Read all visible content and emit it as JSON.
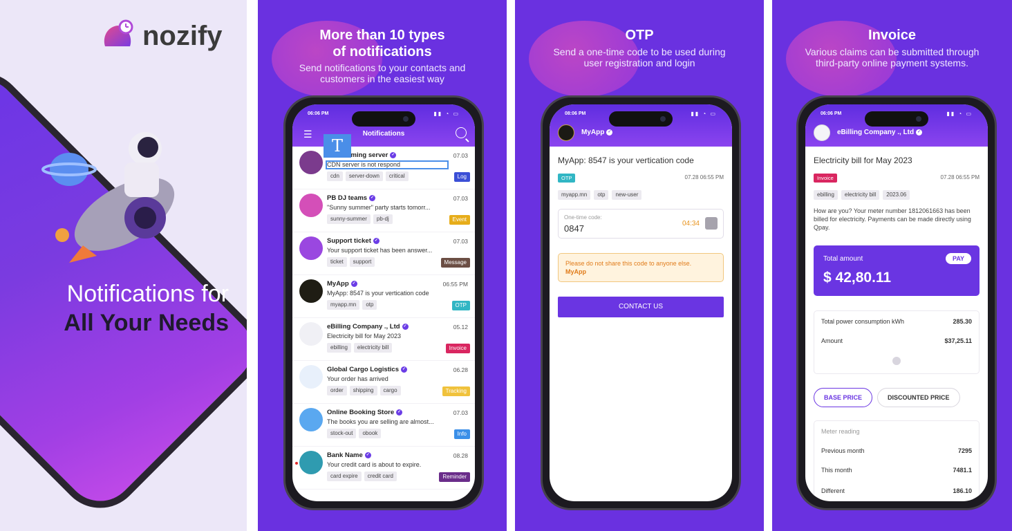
{
  "brand": {
    "name": "nozify"
  },
  "hero": {
    "line1": "Notifications for",
    "line2": "All Your Needs"
  },
  "panel2": {
    "title1": "More than 10 types",
    "title2": "of notifications",
    "subtitle1": "Send notifications to your contacts and",
    "subtitle2": "customers in the easiest way",
    "screen": {
      "time": "06:06 PM",
      "title": "Notifications",
      "items": [
        {
          "name": "ESA Gaming server",
          "date": "07.03",
          "body": "CDN server is not respond",
          "tags": [
            "cdn",
            "server-down",
            "critical"
          ],
          "badge": "Log",
          "badge_color": "#3b4fd6",
          "avatar_color": "#7b3b8d"
        },
        {
          "name": "PB DJ teams",
          "date": "07.03",
          "body": "\"Sunny summer\" party starts tomorr...",
          "tags": [
            "sunny-summer",
            "pb-dj"
          ],
          "badge": "Event",
          "badge_color": "#e7ad1a",
          "avatar_color": "#d44fb8"
        },
        {
          "name": "Support ticket",
          "date": "07.03",
          "body": "Your support ticket has been answer...",
          "tags": [
            "ticket",
            "support"
          ],
          "badge": "Message",
          "badge_color": "#6b4e44",
          "avatar_color": "#9a47e0"
        },
        {
          "name": "MyApp",
          "date": "06:55 PM",
          "body": "MyApp: 8547 is your vertication code",
          "tags": [
            "myapp.mn",
            "otp"
          ],
          "badge": "OTP",
          "badge_color": "#31b6c4",
          "avatar_color": "#1f1d14"
        },
        {
          "name": "eBilling Company ., Ltd",
          "date": "05.12",
          "body": "Electricity bill for May 2023",
          "tags": [
            "ebilling",
            "electricity bill"
          ],
          "badge": "Invoice",
          "badge_color": "#d92660",
          "avatar_color": "#f0f0f5"
        },
        {
          "name": "Global Cargo Logistics",
          "date": "06.28",
          "body": "Your order has arrived",
          "tags": [
            "order",
            "shipping",
            "cargo"
          ],
          "badge": "Tracking",
          "badge_color": "#f0c23c",
          "avatar_color": "#e8f0fb"
        },
        {
          "name": "Online Booking Store",
          "date": "07.03",
          "body": "The books you are selling are almost...",
          "tags": [
            "stock-out",
            "obook"
          ],
          "badge": "Info",
          "badge_color": "#3b8fe8",
          "avatar_color": "#5aa8f0"
        },
        {
          "name": "Bank Name",
          "date": "08.28",
          "body": "Your credit card is about to expire.",
          "tags": [
            "card expire",
            "credit card"
          ],
          "badge": "Reminder",
          "badge_color": "#6a2c8a",
          "avatar_color": "#2f9bb0"
        }
      ]
    }
  },
  "panel3": {
    "title": "OTP",
    "subtitle1": "Send a one-time code to be used during",
    "subtitle2": "user registration and login",
    "screen": {
      "time": "08:06 PM",
      "app_name": "MyApp",
      "message": "MyApp: 8547 is your vertication code",
      "pill": "OTP",
      "pill_color": "#31b6c4",
      "date": "07.28 06:55 PM",
      "tags": [
        "myapp.mn",
        "otp",
        "new-user"
      ],
      "code_label": "One-time code:",
      "code": "0847",
      "timer": "04:34",
      "warning": "Please do not share this code to anyone else.",
      "warning_sender": "MyApp",
      "button": "CONTACT US"
    }
  },
  "panel4": {
    "title": "Invoice",
    "subtitle1": "Various claims can be submitted through",
    "subtitle2": "third-party online payment systems.",
    "screen": {
      "time": "06:06 PM",
      "company": "eBilling Company ., Ltd",
      "title": "Electricity bill for May 2023",
      "pill": "Invoice",
      "pill_color": "#d92660",
      "date": "07.28 06:55 PM",
      "tags": [
        "ebilling",
        "electricity bill",
        "2023.06"
      ],
      "description": "How are you? Your meter number 1812061663 has been billed for electricity. Payments can be made directly using Qpay.",
      "total_label": "Total amount",
      "total": "$ 42,80.11",
      "pay": "PAY",
      "rows": [
        {
          "label": "Total power consumption kWh",
          "value": "285.30"
        },
        {
          "label": "Amount",
          "value": "$37,25.11"
        }
      ],
      "tab_active": "BASE PRICE",
      "tab_other": "DISCOUNTED PRICE",
      "meter_label": "Meter reading",
      "meter_rows": [
        {
          "label": "Previous month",
          "value": "7295"
        },
        {
          "label": "This month",
          "value": "7481.1"
        },
        {
          "label": "Different",
          "value": "186.10"
        }
      ]
    }
  }
}
